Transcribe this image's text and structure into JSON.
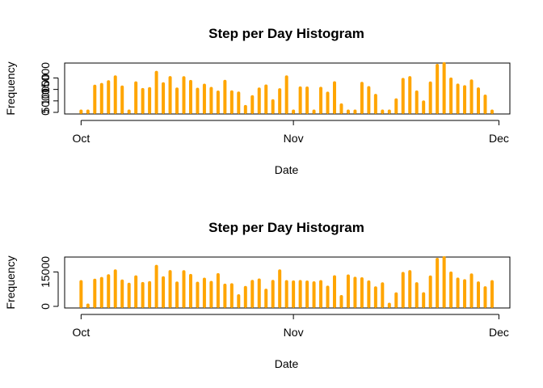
{
  "chart_data": [
    {
      "type": "bar",
      "title": "Step per Day Histogram",
      "xlabel": "Date",
      "ylabel": "Frequency",
      "x_ticks": [
        {
          "label": "Oct",
          "day": 0
        },
        {
          "label": "Nov",
          "day": 31
        },
        {
          "label": "Dec",
          "day": 61
        }
      ],
      "y_ticks": [
        0,
        5000,
        10000,
        15000
      ],
      "ylim": [
        0,
        21500
      ],
      "bar_color": "#FFA500",
      "x": [
        0,
        1,
        2,
        3,
        4,
        5,
        6,
        7,
        8,
        9,
        10,
        11,
        12,
        13,
        14,
        15,
        16,
        17,
        18,
        19,
        20,
        21,
        22,
        23,
        24,
        25,
        26,
        27,
        28,
        29,
        30,
        31,
        32,
        33,
        34,
        35,
        36,
        37,
        38,
        39,
        40,
        41,
        42,
        43,
        44,
        45,
        46,
        47,
        48,
        49,
        50,
        51,
        52,
        53,
        54,
        55,
        56,
        57,
        58,
        59,
        60
      ],
      "values": [
        0,
        126,
        11352,
        12116,
        13294,
        15420,
        11015,
        0,
        12811,
        9900,
        10304,
        17382,
        12426,
        15098,
        10139,
        15084,
        13452,
        10056,
        11829,
        10395,
        8821,
        13460,
        8918,
        8355,
        2492,
        6778,
        10119,
        11458,
        5018,
        9819,
        15414,
        0,
        10600,
        10571,
        0,
        10439,
        8334,
        12883,
        3219,
        0,
        0,
        12608,
        10765,
        7336,
        0,
        41,
        5441,
        14339,
        15110,
        8841,
        4472,
        12787,
        20427,
        21194,
        14478,
        11834,
        11162,
        13646,
        10183,
        7047,
        0
      ]
    },
    {
      "type": "bar",
      "title": "Step per Day Histogram",
      "xlabel": "Date",
      "ylabel": "Frequency",
      "x_ticks": [
        {
          "label": "Oct",
          "day": 0
        },
        {
          "label": "Nov",
          "day": 31
        },
        {
          "label": "Dec",
          "day": 61
        }
      ],
      "y_ticks": [
        0,
        15000
      ],
      "ylim": [
        0,
        21500
      ],
      "bar_color": "#FFA500",
      "x": [
        0,
        1,
        2,
        3,
        4,
        5,
        6,
        7,
        8,
        9,
        10,
        11,
        12,
        13,
        14,
        15,
        16,
        17,
        18,
        19,
        20,
        21,
        22,
        23,
        24,
        25,
        26,
        27,
        28,
        29,
        30,
        31,
        32,
        33,
        34,
        35,
        36,
        37,
        38,
        39,
        40,
        41,
        42,
        43,
        44,
        45,
        46,
        47,
        48,
        49,
        50,
        51,
        52,
        53,
        54,
        55,
        56,
        57,
        58,
        59,
        60
      ],
      "values": [
        10766,
        126,
        11352,
        12116,
        13294,
        15420,
        11015,
        9600,
        12811,
        9900,
        10304,
        17382,
        12426,
        15098,
        10139,
        15084,
        13452,
        10056,
        11829,
        10395,
        13800,
        9200,
        9400,
        4600,
        8200,
        10819,
        11458,
        7018,
        10819,
        15414,
        10766,
        10600,
        10800,
        10571,
        10200,
        10766,
        8334,
        12883,
        4219,
        13200,
        12200,
        12000,
        10600,
        8000,
        9800,
        900,
        5441,
        14339,
        15110,
        9841,
        5472,
        12787,
        20427,
        21194,
        14478,
        11834,
        11162,
        13646,
        10183,
        8047,
        10766
      ]
    }
  ]
}
